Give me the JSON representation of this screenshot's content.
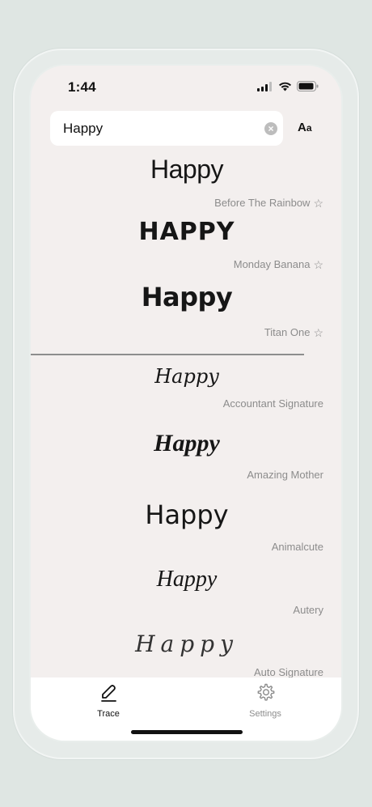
{
  "status_bar": {
    "time": "1:44"
  },
  "search": {
    "value": "Happy"
  },
  "font_size_toggle": {
    "large": "A",
    "small": "a"
  },
  "fonts": [
    {
      "sample": "Happy",
      "name": "Before The Rainbow",
      "favorite": false
    },
    {
      "sample": "HAPPY",
      "name": "Monday Banana",
      "favorite": false
    },
    {
      "sample": "Happy",
      "name": "Titan One",
      "favorite": false
    },
    {
      "sample": "Happy",
      "name": "Accountant Signature"
    },
    {
      "sample": "Happy",
      "name": "Amazing Mother"
    },
    {
      "sample": "Happy",
      "name": "Animalcute"
    },
    {
      "sample": "Happy",
      "name": "Autery"
    },
    {
      "sample": "Happy",
      "name": "Auto Signature"
    }
  ],
  "tabs": [
    {
      "label": "Trace",
      "icon": "pencil-icon",
      "active": true
    },
    {
      "label": "Settings",
      "icon": "gear-icon",
      "active": false
    }
  ],
  "colors": {
    "background": "#dfe6e3",
    "screen": "#f3efee",
    "text": "#161616",
    "secondary_text": "#8c8c8c"
  }
}
